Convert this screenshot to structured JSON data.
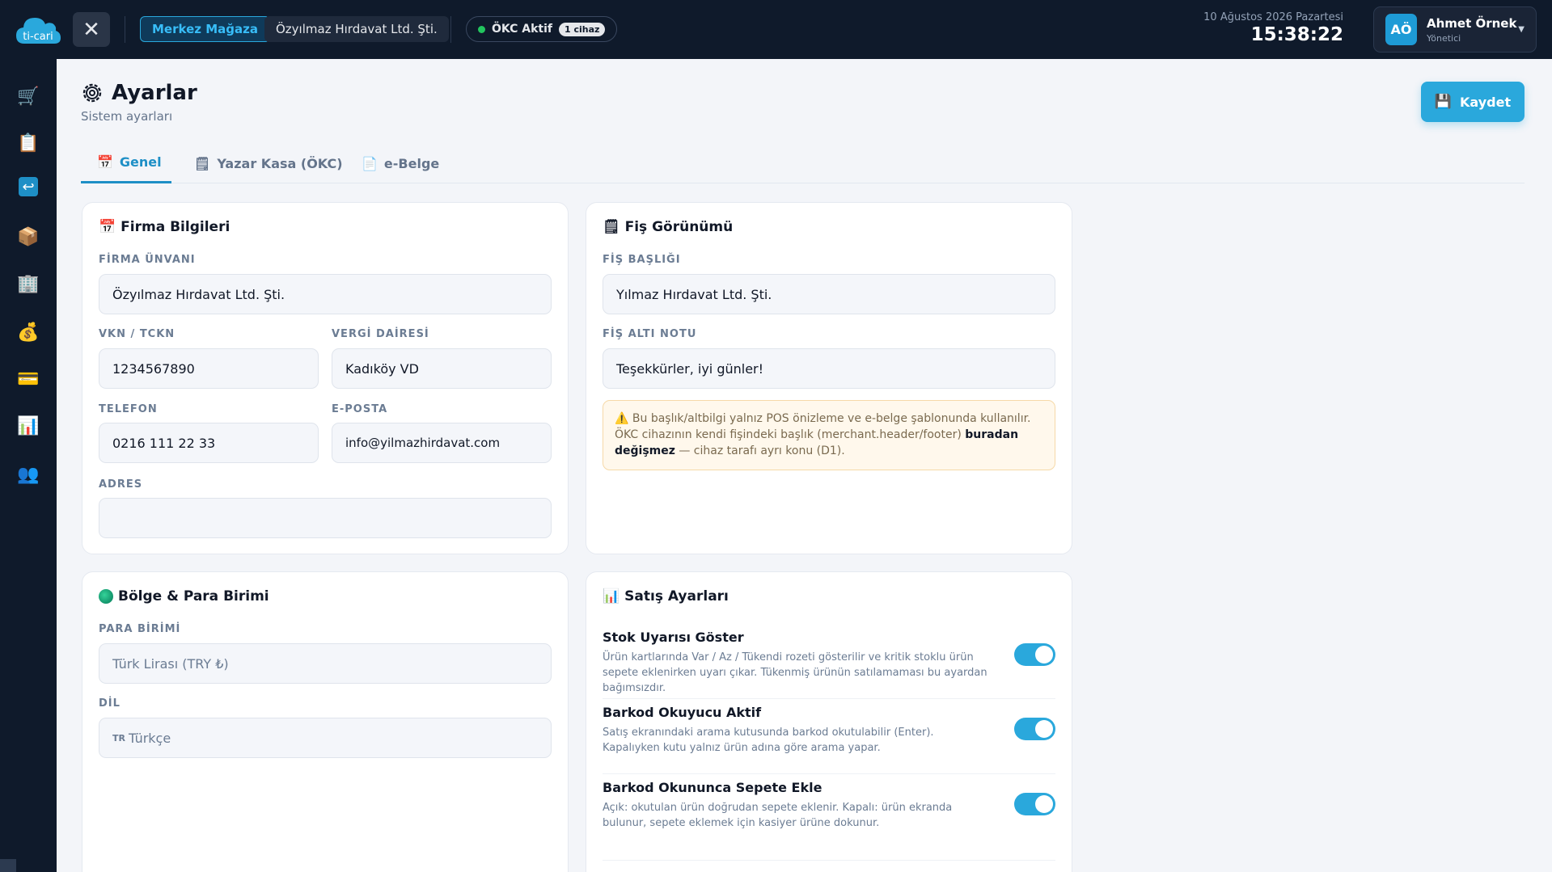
{
  "topbar": {
    "logo_text": "ti-cari",
    "store": "Merkez Mağaza",
    "company": "Özyılmaz Hırdavat Ltd. Şti.",
    "okc_status": "ÖKC Aktif",
    "okc_devices": "1 cihaz",
    "date": "10 Ağustos 2026 Pazartesi",
    "time": "15:38:22",
    "user": {
      "initials": "AÖ",
      "name": "Ahmet Örnek",
      "role": "Yönetici"
    }
  },
  "sidebar": {
    "items": [
      {
        "icon": "cart-icon",
        "glyph": "🛒"
      },
      {
        "icon": "clipboard-icon",
        "glyph": "📋"
      },
      {
        "icon": "return-icon",
        "glyph": "↩"
      },
      {
        "icon": "package-icon",
        "glyph": "📦"
      },
      {
        "icon": "building-icon",
        "glyph": "🏢"
      },
      {
        "icon": "money-bag-icon",
        "glyph": "💰"
      },
      {
        "icon": "credit-card-icon",
        "glyph": "💳"
      },
      {
        "icon": "bar-chart-icon",
        "glyph": "📊"
      },
      {
        "icon": "users-icon",
        "glyph": "👥"
      }
    ]
  },
  "page": {
    "title": "Ayarlar",
    "subtitle": "Sistem ayarları",
    "save_label": "Kaydet"
  },
  "tabs": [
    {
      "label": "Genel",
      "active": true
    },
    {
      "label": "Yazar Kasa (ÖKC)",
      "active": false
    },
    {
      "label": "e-Belge",
      "active": false
    }
  ],
  "firma": {
    "title": "Firma Bilgileri",
    "unvan_label": "FİRMA ÜNVANI",
    "unvan": "Özyılmaz Hırdavat Ltd. Şti.",
    "vkn_label": "VKN / TCKN",
    "vkn": "1234567890",
    "vergi_label": "VERGİ DAİRESİ",
    "vergi": "Kadıköy VD",
    "tel_label": "TELEFON",
    "tel": "0216 111 22 33",
    "eposta_label": "E-POSTA",
    "eposta": "info@yilmazhirdavat.com",
    "adres_label": "ADRES",
    "adres": ""
  },
  "fis": {
    "title": "Fiş Görünümü",
    "baslik_label": "FİŞ BAŞLIĞI",
    "baslik": "Yılmaz Hırdavat Ltd. Şti.",
    "alt_label": "FİŞ ALTI NOTU",
    "alt": "Teşekkürler, iyi günler!",
    "warn_1": "Bu başlık/altbilgi yalnız POS önizleme ve e-belge şablonunda kullanılır. ÖKC cihazının kendi fişindeki başlık (merchant.header/footer) ",
    "warn_bold": "buradan değişmez",
    "warn_2": " — cihaz tarafı ayrı konu (D1)."
  },
  "bolge": {
    "title": "Bölge & Para Birimi",
    "para_label": "PARA BİRİMİ",
    "para": "Türk Lirası (TRY ₺)",
    "dil_label": "DİL",
    "dil_prefix": "TR",
    "dil": "Türkçe"
  },
  "satis": {
    "title": "Satış Ayarları",
    "toggles": [
      {
        "title": "Stok Uyarısı Göster",
        "desc": "Ürün kartlarında Var / Az / Tükendi rozeti gösterilir ve kritik stoklu ürün sepete eklenirken uyarı çıkar. Tükenmiş ürünün satılamaması bu ayardan bağımsızdır.",
        "on": true
      },
      {
        "title": "Barkod Okuyucu Aktif",
        "desc": "Satış ekranındaki arama kutusunda barkod okutulabilir (Enter). Kapalıyken kutu yalnız ürün adına göre arama yapar.",
        "on": true
      },
      {
        "title": "Barkod Okununca Sepete Ekle",
        "desc": "Açık: okutulan ürün doğrudan sepete eklenir. Kapalı: ürün ekranda bulunur, sepete eklemek için kasiyer ürüne dokunur.",
        "on": true
      }
    ]
  },
  "colors": {
    "accent": "#2aa8dc",
    "topbar": "#0f1a2b",
    "success": "#22c55e"
  }
}
